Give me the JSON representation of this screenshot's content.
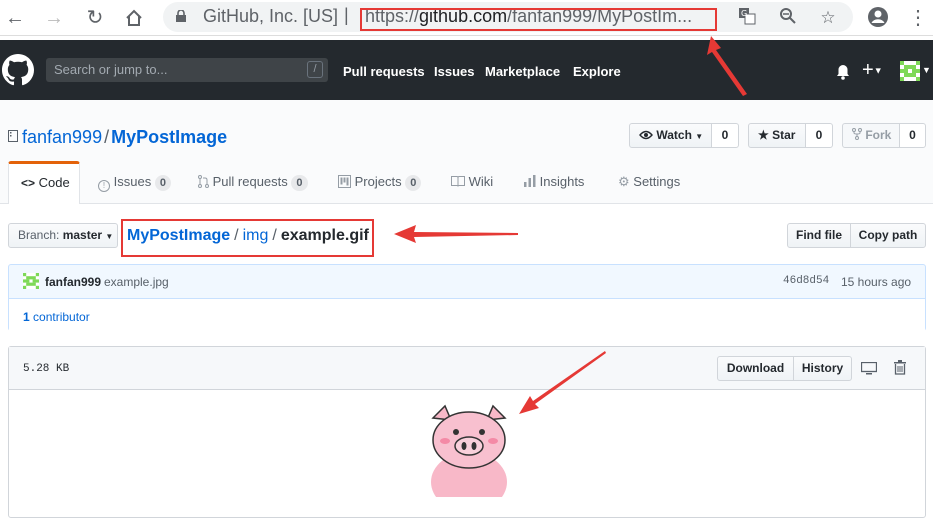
{
  "browser": {
    "organization": "GitHub, Inc. [US]",
    "url_prefix": "https://",
    "url_domain": "github.com",
    "url_path": "/fanfan999/MyPostIm..."
  },
  "header": {
    "search_placeholder": "Search or jump to...",
    "slash_key": "/",
    "nav": [
      "Pull requests",
      "Issues",
      "Marketplace",
      "Explore"
    ]
  },
  "repo": {
    "owner": "fanfan999",
    "separator": "/",
    "name": "MyPostImage",
    "watch_label": "Watch",
    "watch_count": "0",
    "star_label": "Star",
    "star_count": "0",
    "fork_label": "Fork",
    "fork_count": "0"
  },
  "tabs": [
    {
      "label": "Code"
    },
    {
      "label": "Issues",
      "count": "0"
    },
    {
      "label": "Pull requests",
      "count": "0"
    },
    {
      "label": "Projects",
      "count": "0"
    },
    {
      "label": "Wiki"
    },
    {
      "label": "Insights"
    },
    {
      "label": "Settings"
    }
  ],
  "branch": {
    "prefix": "Branch:",
    "name": "master"
  },
  "breadcrumb": {
    "repo": "MyPostImage",
    "dir": "img",
    "file": "example.gif",
    "sep": "/"
  },
  "file_actions": {
    "find_file": "Find file",
    "copy_path": "Copy path"
  },
  "commit": {
    "author": "fanfan999",
    "message": "example.jpg",
    "sha": "46d8d54",
    "time": "15 hours ago",
    "contributors_count": "1",
    "contributors_label": "contributor"
  },
  "file": {
    "size": "5.28 KB",
    "download": "Download",
    "history": "History"
  },
  "colors": {
    "annotation_red": "#e53935",
    "header_bg": "#24292e",
    "link": "#0366d6",
    "pig_pink": "#f8b8c8"
  }
}
